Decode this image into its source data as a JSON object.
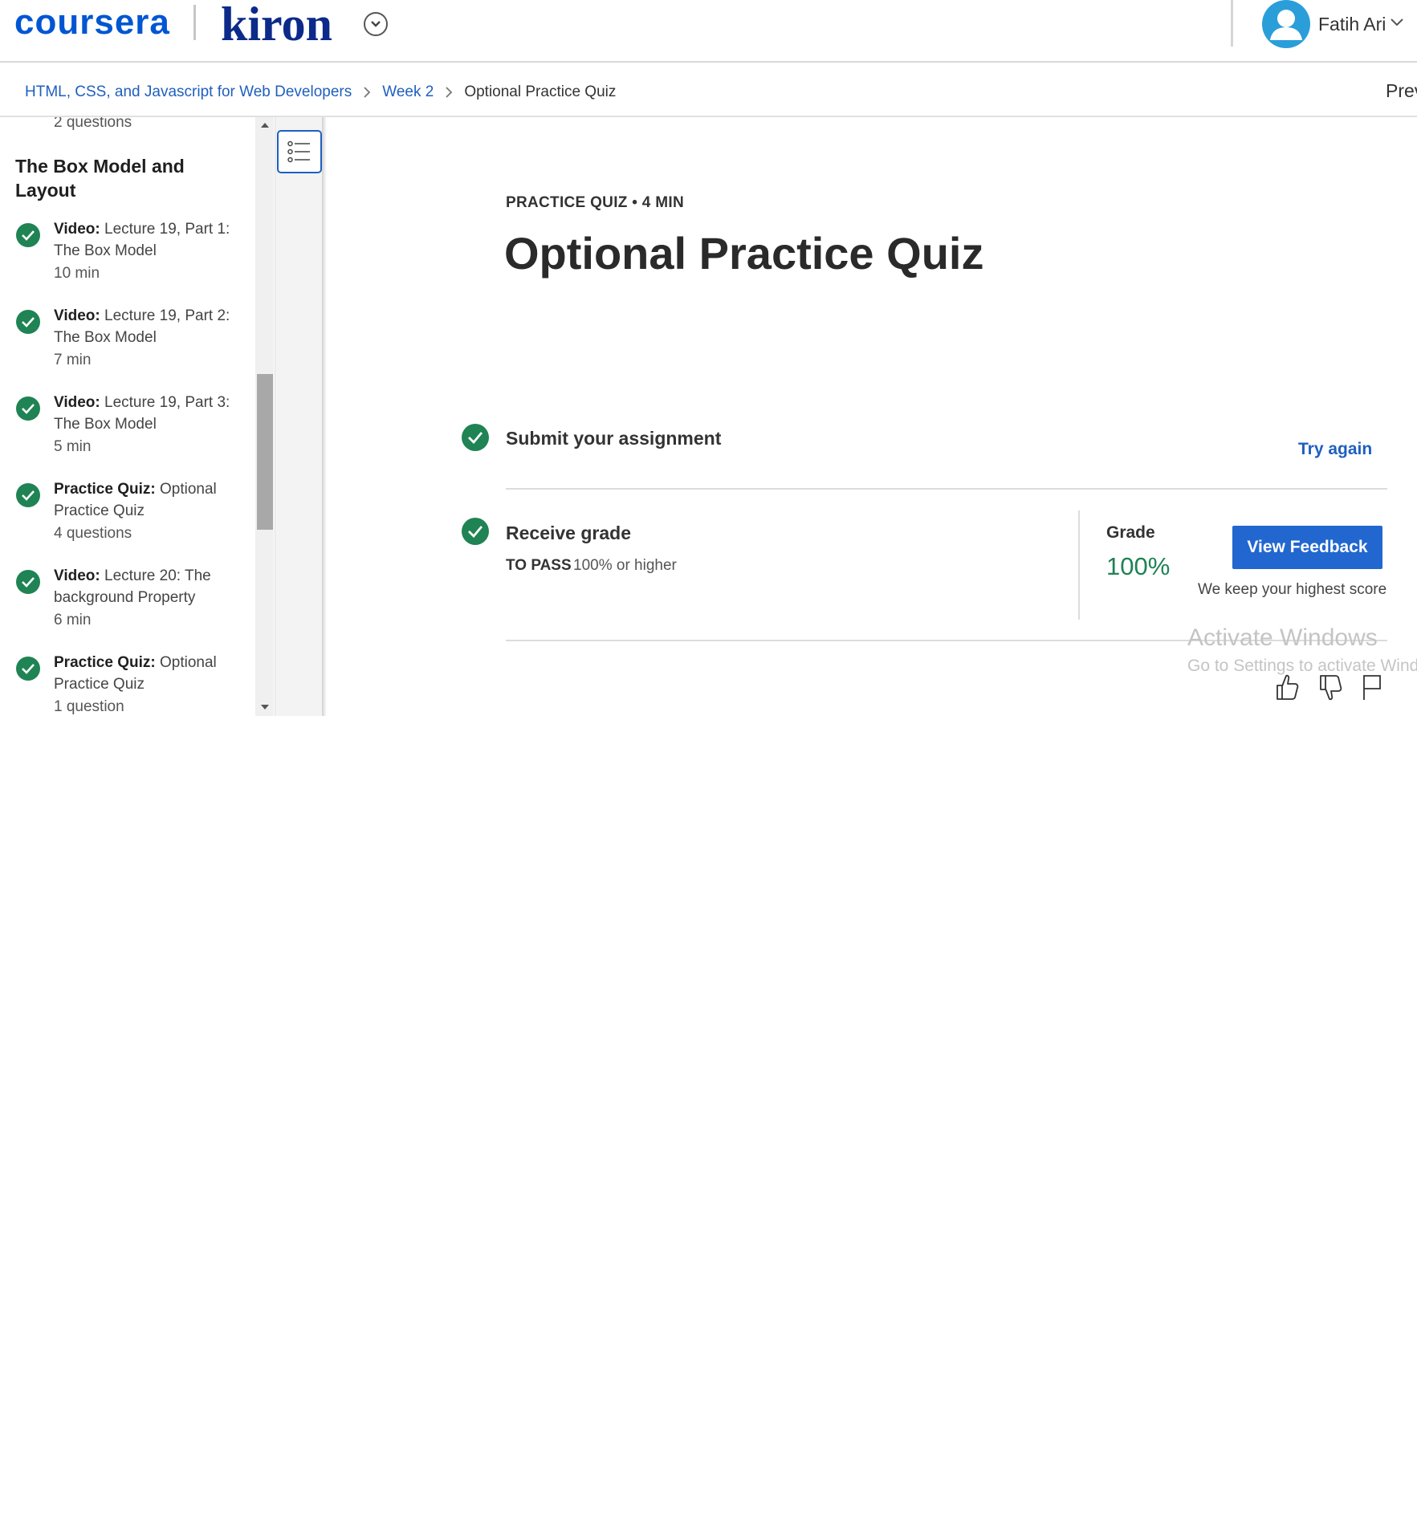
{
  "header": {
    "brand": "coursera",
    "partner": "kiron",
    "user_name": "Fatih Ari"
  },
  "breadcrumb": {
    "items": [
      "HTML, CSS, and Javascript for Web Developers",
      "Week 2",
      "Optional Practice Quiz"
    ],
    "prev_label": "Prev"
  },
  "sidebar": {
    "top_meta": "2 questions",
    "section_title": "The Box Model and Layout",
    "items": [
      {
        "type": "Video:",
        "title": "Lecture 19, Part 1: The Box Model",
        "meta": "10 min"
      },
      {
        "type": "Video:",
        "title": "Lecture 19, Part 2: The Box Model",
        "meta": "7 min"
      },
      {
        "type": "Video:",
        "title": "Lecture 19, Part 3: The Box Model",
        "meta": "5 min"
      },
      {
        "type": "Practice Quiz:",
        "title": "Optional Practice Quiz",
        "meta": "4 questions"
      },
      {
        "type": "Video:",
        "title": "Lecture 20: The background Property",
        "meta": "6 min"
      },
      {
        "type": "Practice Quiz:",
        "title": "Optional Practice Quiz",
        "meta": "1 question"
      }
    ]
  },
  "main": {
    "kicker": "PRACTICE QUIZ • 4 MIN",
    "title": "Optional Practice Quiz",
    "submit_step": "Submit your assignment",
    "try_again": "Try again",
    "receive_step": "Receive grade",
    "to_pass_label": "TO PASS",
    "to_pass_value": "100% or higher",
    "grade_label": "Grade",
    "grade_value": "100%",
    "view_feedback": "View Feedback",
    "keep_note": "We keep your highest score"
  },
  "watermark": {
    "title": "Activate Windows",
    "subtitle": "Go to Settings to activate Windows."
  },
  "colors": {
    "brand_blue": "#0056d2",
    "link_blue": "#1f5fbf",
    "success_green": "#1f8354",
    "button_blue": "#2267d0"
  }
}
